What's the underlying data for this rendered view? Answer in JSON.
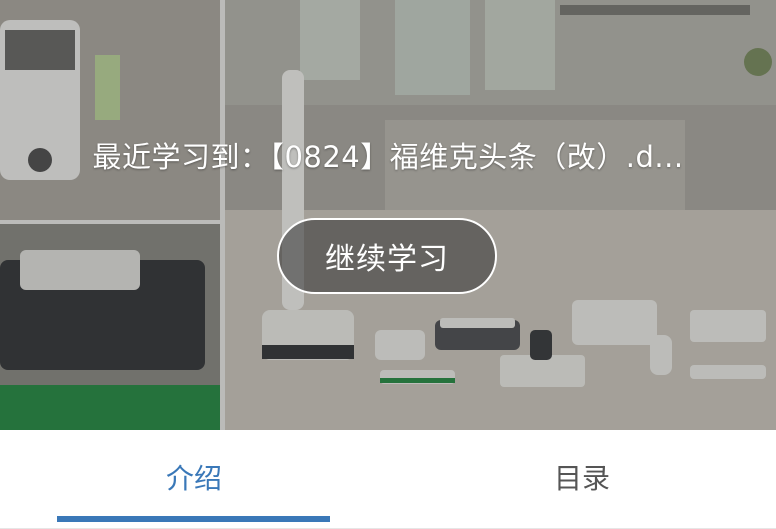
{
  "hero": {
    "recent_label": "最近学习到：",
    "recent_course": "【0824】福维克头条（改）.d...",
    "continue_label": "继续学习"
  },
  "tabs": [
    {
      "label": "介绍",
      "active": true
    },
    {
      "label": "目录",
      "active": false
    }
  ],
  "colors": {
    "accent": "#3a78b8",
    "inactive_tab": "#555555"
  }
}
